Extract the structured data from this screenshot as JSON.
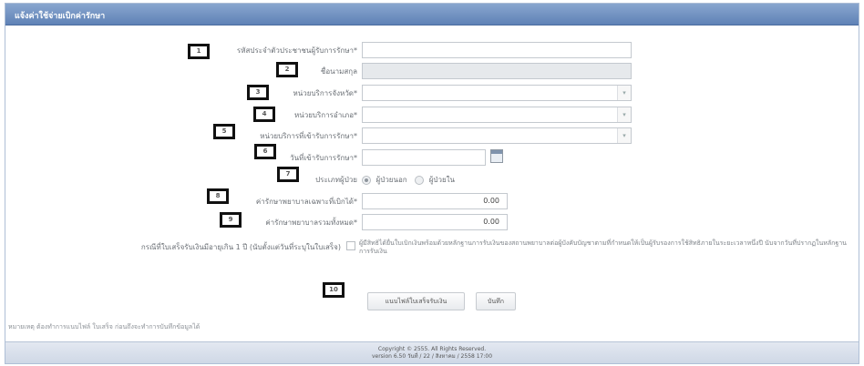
{
  "panel": {
    "title": "แจ้งค่าใช้จ่ายเบิกค่ารักษา"
  },
  "form": {
    "citizen_id": {
      "label": "รหัสประจำตัวประชาชนผู้รับการรักษา*",
      "value": ""
    },
    "full_name": {
      "label": "ชื่อนามสกุล",
      "value": ""
    },
    "province": {
      "label": "หน่วยบริการจังหวัด*",
      "value": ""
    },
    "district": {
      "label": "หน่วยบริการอำเภอ*",
      "value": ""
    },
    "hospital": {
      "label": "หน่วยบริการที่เข้ารับการรักษา*",
      "value": ""
    },
    "service_date": {
      "label": "วันที่เข้ารับการรักษา*",
      "value": ""
    },
    "patient_type": {
      "label": "ประเภทผู้ป่วย",
      "options": [
        "ผู้ป่วยนอก",
        "ผู้ป่วยใน"
      ],
      "selected": "ผู้ป่วยนอก"
    },
    "claimable_cost": {
      "label": "ค่ารักษาพยาบาลเฉพาะที่เบิกได้*",
      "value": "0.00"
    },
    "total_cost": {
      "label": "ค่ารักษาพยาบาลรวมทั้งหมด*",
      "value": "0.00"
    },
    "late_claim": {
      "label": "กรณีที่ใบเสร็จรับเงินมีอายุเกิน 1 ปี (นับตั้งแต่วันที่ระบุในใบเสร็จ)",
      "text": "ผู้มีสิทธิได้ยื่นใบเบิกเงินพร้อมด้วยหลักฐานการรับเงินของสถานพยาบาลต่อผู้บังคับบัญชาตามที่กำหนดให้เป็นผู้รับรองการใช้สิทธิภายในระยะเวลาหนึ่งปี นับจากวันที่ปรากฏในหลักฐานการรับเงิน"
    }
  },
  "buttons": {
    "attach_receipt": "แนบไฟล์ใบเสร็จรับเงิน",
    "save": "บันทึก"
  },
  "note": "หมายเหตุ ต้องทำการแนบไฟล์ ใบเสร็จ ก่อนถึงจะทำการบันทึกข้อมูลได้",
  "footer": {
    "copyright": "Copyright © 2555. All Rights Reserved.",
    "version": "version 6.50 วันที่ / 22 / สิงหาคม / 2558 17:00"
  },
  "badges": [
    "1",
    "2",
    "3",
    "4",
    "5",
    "6",
    "7",
    "8",
    "9",
    "10"
  ],
  "colors": {
    "header": "#6f8fc1",
    "footer": "#d6deea",
    "badge_border": "#111111"
  }
}
